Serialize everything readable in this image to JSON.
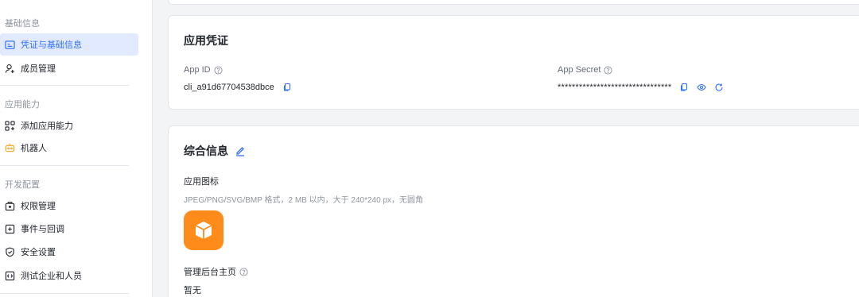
{
  "sidebar": {
    "groups": [
      {
        "title": "基础信息",
        "items": [
          {
            "label": "凭证与基础信息",
            "icon": "id-card-icon",
            "active": true
          },
          {
            "label": "成员管理",
            "icon": "user-add-icon",
            "active": false
          }
        ]
      },
      {
        "title": "应用能力",
        "items": [
          {
            "label": "添加应用能力",
            "icon": "apps-add-icon",
            "active": false
          },
          {
            "label": "机器人",
            "icon": "robot-icon",
            "active": false
          }
        ]
      },
      {
        "title": "开发配置",
        "items": [
          {
            "label": "权限管理",
            "icon": "lock-box-icon",
            "active": false
          },
          {
            "label": "事件与回调",
            "icon": "event-plus-icon",
            "active": false
          },
          {
            "label": "安全设置",
            "icon": "shield-check-icon",
            "active": false
          },
          {
            "label": "测试企业和人员",
            "icon": "code-box-icon",
            "active": false
          }
        ]
      }
    ]
  },
  "credentials": {
    "title": "应用凭证",
    "app_id_label": "App ID",
    "app_id_value": "cli_a91d67704538dbce",
    "app_secret_label": "App Secret",
    "app_secret_value": "********************************"
  },
  "info": {
    "title": "综合信息",
    "icon_label": "应用图标",
    "icon_hint": "JPEG/PNG/SVG/BMP 格式，2 MB 以内，大于 240*240 px，无圆角",
    "admin_label": "管理后台主页",
    "admin_value": "暂无"
  },
  "colors": {
    "accent": "#3370ff",
    "active_bg": "#e1eaff",
    "app_icon_bg": "#ff8b1a",
    "robot_orange": "#f5a623"
  }
}
